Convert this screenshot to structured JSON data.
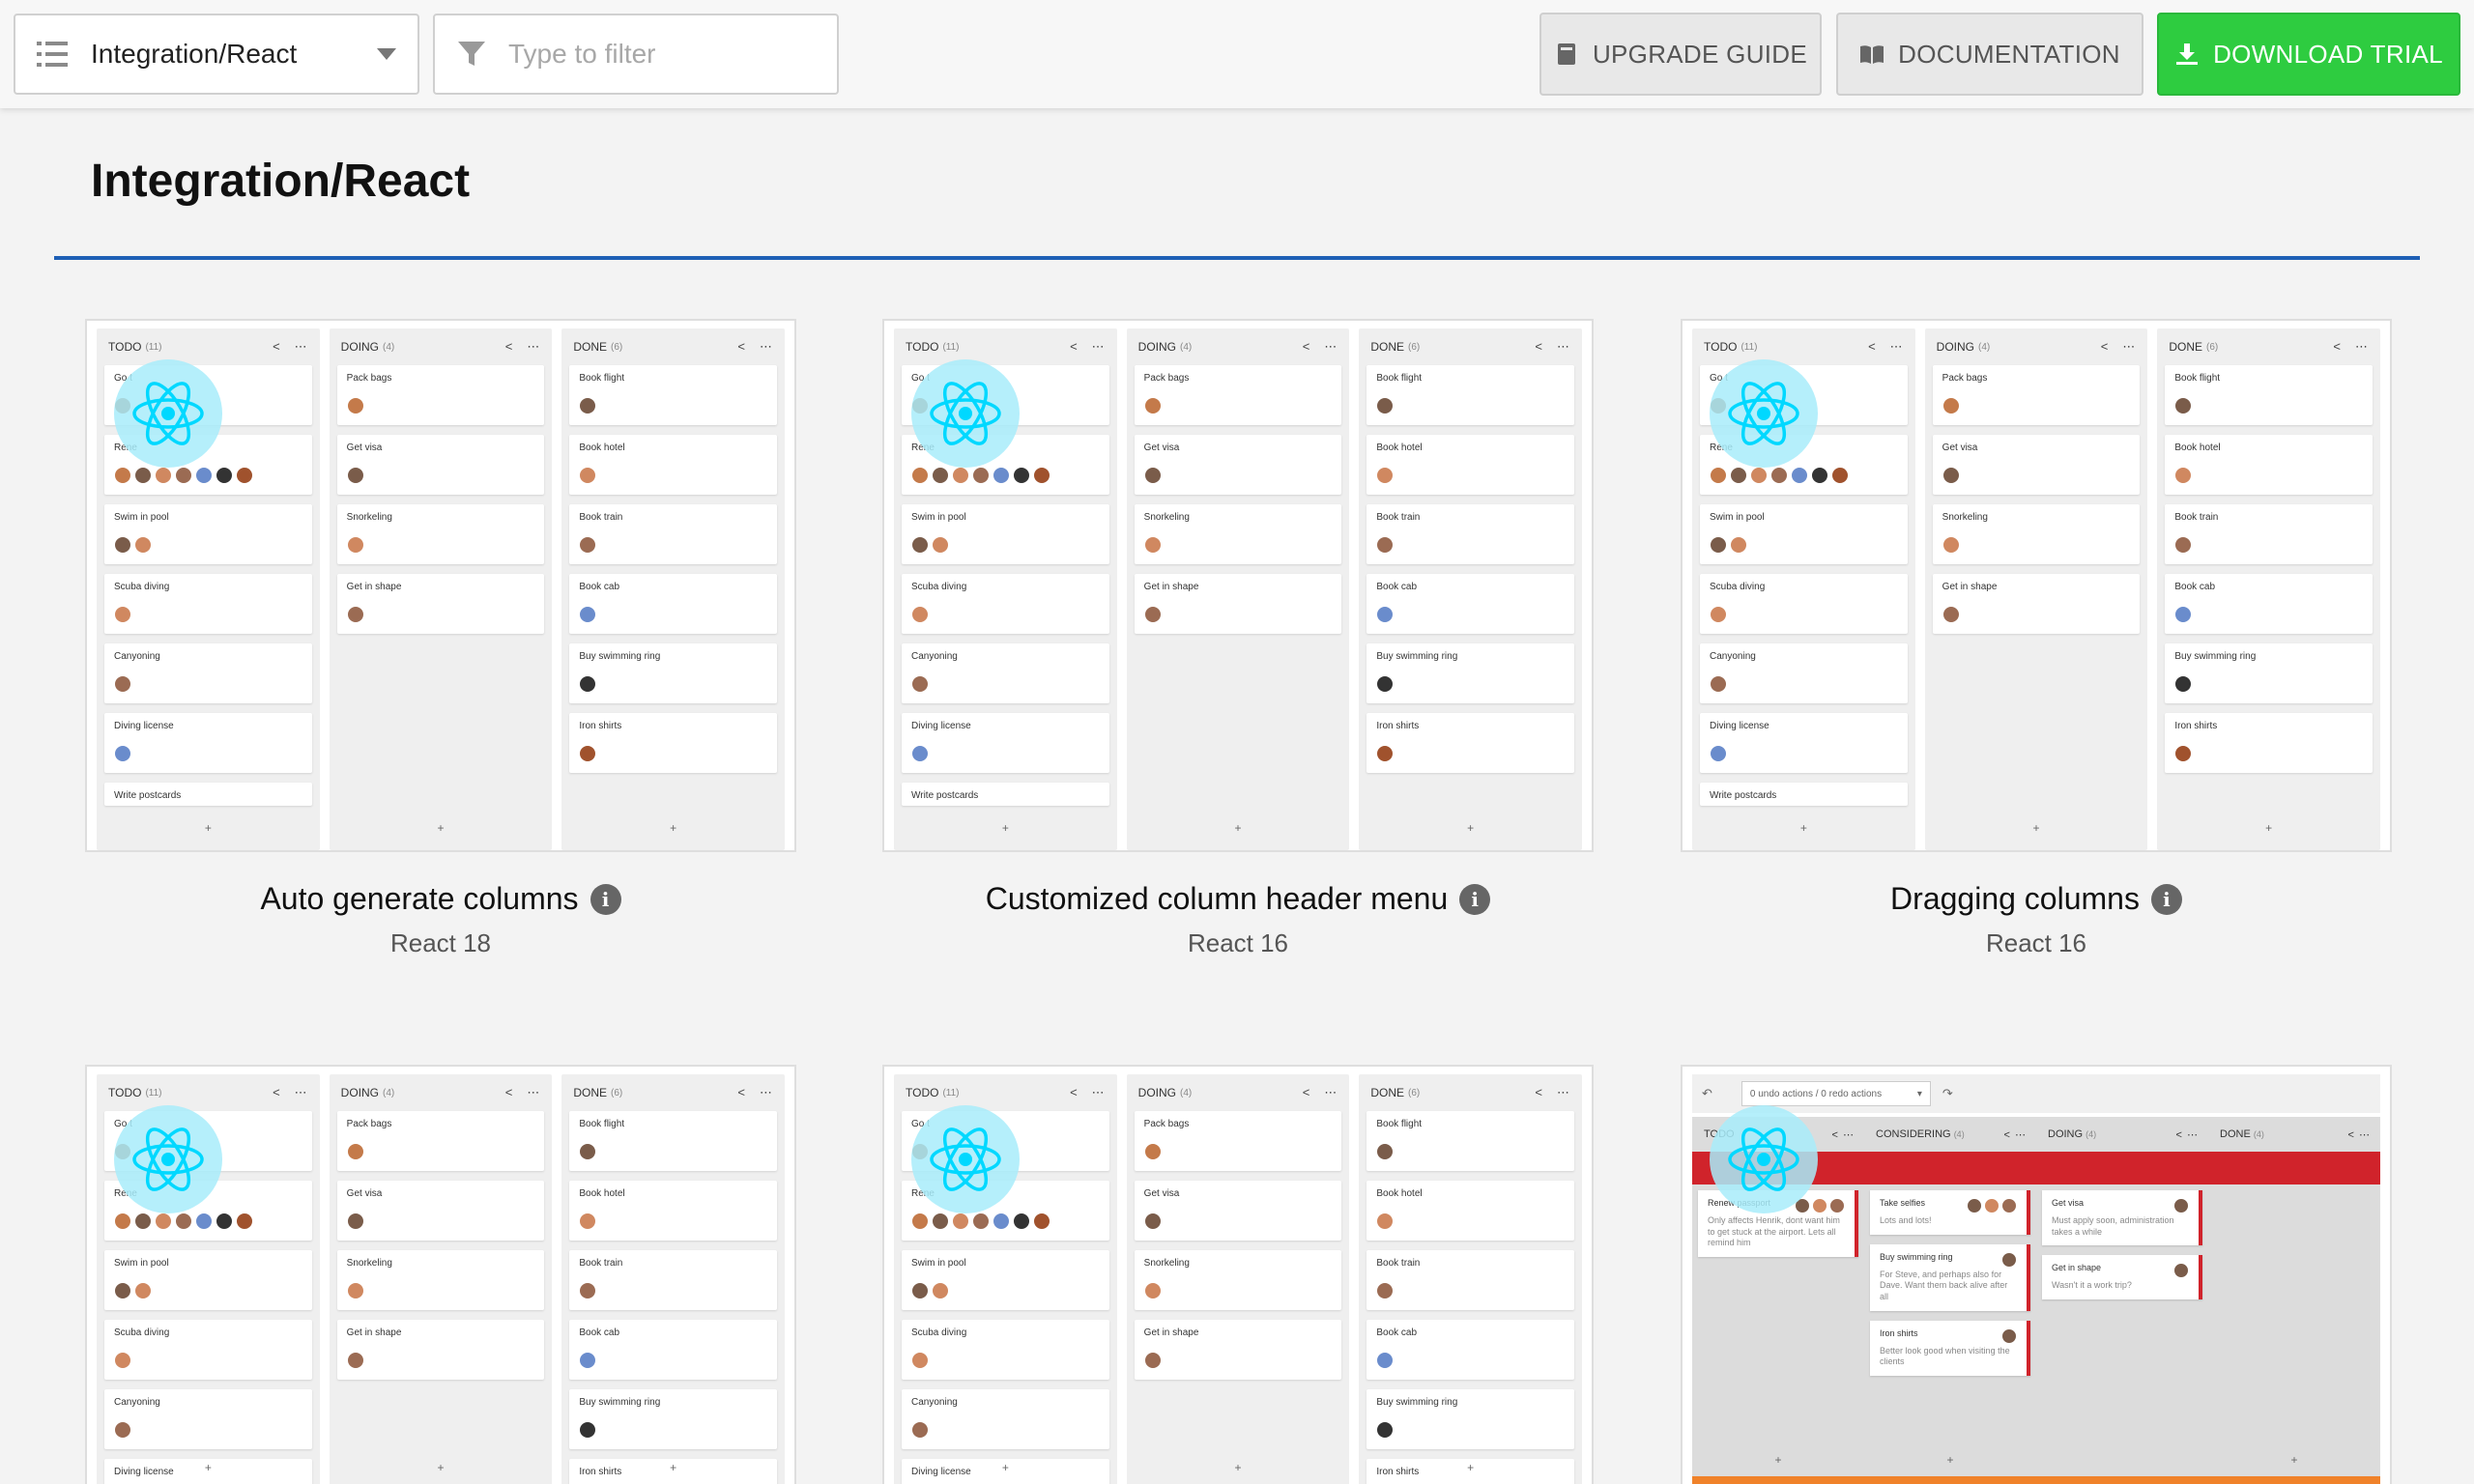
{
  "toolbar": {
    "selector_value": "Integration/React",
    "filter_placeholder": "Type to filter",
    "upgrade_label": "UPGRADE GUIDE",
    "docs_label": "DOCUMENTATION",
    "trial_label": "DOWNLOAD TRIAL",
    "trial_color": "#2ecc40"
  },
  "page": {
    "title": "Integration/React",
    "rule_color": "#1e5fb5"
  },
  "board": {
    "columns": [
      {
        "name": "TODO",
        "count": "(11)",
        "cards": [
          "Go to Ibiza",
          "Renew passport",
          "Swim in pool",
          "Scuba diving",
          "Canyoning",
          "Diving license",
          "Write postcards"
        ]
      },
      {
        "name": "DOING",
        "count": "(4)",
        "cards": [
          "Pack bags",
          "Get visa",
          "Snorkeling",
          "Get in shape"
        ]
      },
      {
        "name": "DONE",
        "count": "(6)",
        "cards": [
          "Book flight",
          "Book hotel",
          "Book train",
          "Book cab",
          "Buy swimming ring",
          "Iron shirts"
        ]
      }
    ],
    "add_symbol": "+",
    "tools_collapse": "<",
    "tools_menu": "⋯"
  },
  "cards": [
    {
      "title": "Auto generate columns",
      "subtitle": "React 18"
    },
    {
      "title": "Customized column header menu",
      "subtitle": "React 16"
    },
    {
      "title": "Dragging columns",
      "subtitle": "React 16"
    }
  ],
  "undo_demo": {
    "selector": "0 undo actions / 0 redo actions",
    "undo_symbol": "↶",
    "redo_symbol": "↷",
    "columns": [
      "TODO",
      "CONSIDERING",
      "DOING",
      "DONE"
    ],
    "counts": [
      "(11)",
      "(4)",
      "(4)",
      "(4)"
    ],
    "col1_cards": [
      {
        "title": "Renew passport",
        "desc": "Only affects Henrik, dont want him to get stuck at the airport. Lets all remind him"
      }
    ],
    "col2_cards": [
      {
        "title": "Take selfies",
        "desc": "Lots and lots!"
      },
      {
        "title": "Buy swimming ring",
        "desc": "For Steve, and perhaps also for Dave. Want them back alive after all"
      },
      {
        "title": "Iron shirts",
        "desc": "Better look good when visiting the clients"
      }
    ],
    "col3_cards": [
      {
        "title": "Get visa",
        "desc": "Must apply soon, administration takes a while"
      },
      {
        "title": "Get in shape",
        "desc": "Wasn't it a work trip?"
      }
    ],
    "band_red": "#d0232b",
    "band_orange": "#f0822a"
  },
  "colors": {
    "react_cyan": "#00d8ff",
    "react_bubble": "#a8ecfa"
  }
}
